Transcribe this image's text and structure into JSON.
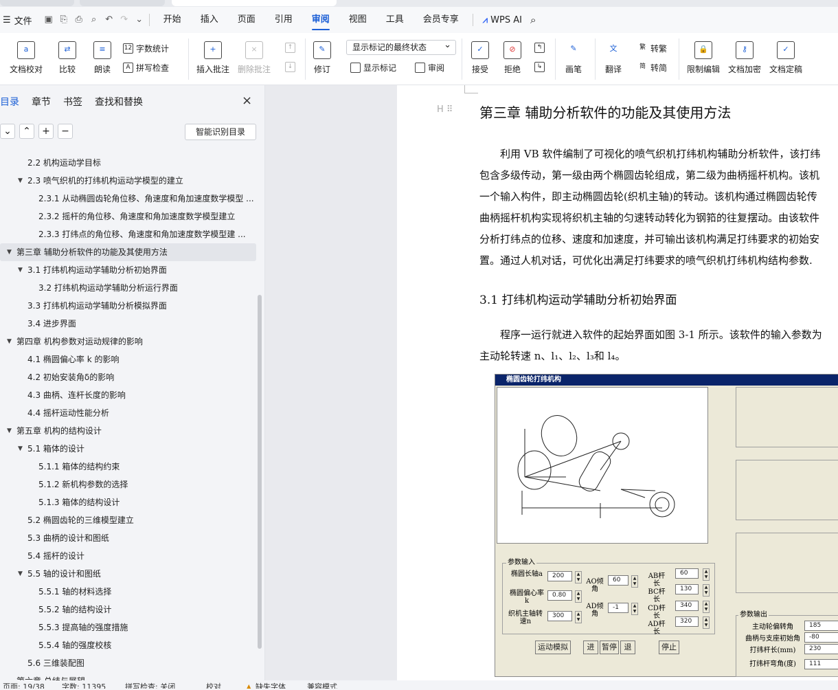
{
  "menu": {
    "file_label": "文件",
    "tabs": [
      "开始",
      "插入",
      "页面",
      "引用",
      "审阅",
      "视图",
      "工具",
      "会员专享"
    ],
    "active_tab": "审阅",
    "wps_ai": "WPS AI"
  },
  "ribbon": {
    "doc_check": "文档校对",
    "compare": "比较",
    "read_aloud": "朗读",
    "word_count": "字数统计",
    "spell_check": "拼写检查",
    "insert_comment": "插入批注",
    "delete_comment": "删除批注",
    "revise": "修订",
    "markup_state": "显示标记的最终状态",
    "show_markup": "显示标记",
    "review": "审阅",
    "accept": "接受",
    "reject": "拒绝",
    "pen": "画笔",
    "translate": "翻译",
    "to_traditional": "转繁",
    "to_simplified": "转简",
    "restrict_edit": "限制编辑",
    "encrypt": "文档加密",
    "finalize": "文档定稿"
  },
  "nav": {
    "tabs": [
      "目录",
      "章节",
      "书签",
      "查找和替换"
    ],
    "active_tab": "目录",
    "smart_toc": "智能识别目录",
    "items": [
      {
        "label": "2.2 机构运动学目标",
        "level": 2,
        "arrow": false
      },
      {
        "label": "2.3 喷气织机的打纬机构运动学模型的建立",
        "level": 2,
        "arrow": true
      },
      {
        "label": "2.3.1 从动椭圆齿轮角位移、角速度和角加速度数学模型 ...",
        "level": 3,
        "arrow": false
      },
      {
        "label": "2.3.2 摇杆的角位移、角速度和角加速度数学模型建立",
        "level": 3,
        "arrow": false
      },
      {
        "label": "2.3.3  打纬点的角位移、角速度和角加速度数学模型建 ...",
        "level": 3,
        "arrow": false
      },
      {
        "label": "第三章  辅助分析软件的功能及其使用方法",
        "level": 1,
        "arrow": true,
        "selected": true
      },
      {
        "label": "3.1  打纬机构运动学辅助分析初始界面",
        "level": 2,
        "arrow": true
      },
      {
        "label": "3.2 打纬机构运动学辅助分析运行界面",
        "level": 3,
        "arrow": false
      },
      {
        "label": "3.3  打纬机构运动学辅助分析模拟界面",
        "level": 2,
        "arrow": false
      },
      {
        "label": "3.4 进步界面",
        "level": 2,
        "arrow": false
      },
      {
        "label": "第四章  机构参数对运动规律的影响",
        "level": 1,
        "arrow": true
      },
      {
        "label": "4.1  椭圆偏心率 k 的影响",
        "level": 2,
        "arrow": false
      },
      {
        "label": "4.2  初始安装角δ的影响",
        "level": 2,
        "arrow": false
      },
      {
        "label": "4.3  曲柄、连杆长度的影响",
        "level": 2,
        "arrow": false
      },
      {
        "label": "4.4  摇杆运动性能分析",
        "level": 2,
        "arrow": false
      },
      {
        "label": "第五章  机构的结构设计",
        "level": 1,
        "arrow": true
      },
      {
        "label": "5.1  箱体的设计",
        "level": 2,
        "arrow": true
      },
      {
        "label": "5.1.1  箱体的结构约束",
        "level": 3,
        "arrow": false
      },
      {
        "label": "5.1.2  新机构参数的选择",
        "level": 3,
        "arrow": false
      },
      {
        "label": "5.1.3  箱体的结构设计",
        "level": 3,
        "arrow": false
      },
      {
        "label": "5.2  椭圆齿轮的三维模型建立",
        "level": 2,
        "arrow": false
      },
      {
        "label": "5.3  曲柄的设计和图纸",
        "level": 2,
        "arrow": false
      },
      {
        "label": "5.4  摇杆的设计",
        "level": 2,
        "arrow": false
      },
      {
        "label": "5.5 轴的设计和图纸",
        "level": 2,
        "arrow": true
      },
      {
        "label": "5.5.1  轴的材料选择",
        "level": 3,
        "arrow": false
      },
      {
        "label": "5.5.2  轴的结构设计",
        "level": 3,
        "arrow": false
      },
      {
        "label": "5.5.3 提高轴的强度措施",
        "level": 3,
        "arrow": false
      },
      {
        "label": "5.5.4  轴的强度校核",
        "level": 3,
        "arrow": false
      },
      {
        "label": "5.6  三维装配图",
        "level": 2,
        "arrow": false
      },
      {
        "label": "第六章  总结与展望",
        "level": 1,
        "arrow": false
      }
    ]
  },
  "doc": {
    "heading": "第三章  辅助分析软件的功能及其使用方法",
    "para1": [
      "利用 VB 软件编制了可视化的喷气织机打纬机构辅助分析软件，该打纬",
      "包含多级传动，第一级由两个椭圆齿轮组成，第二级为曲柄摇杆机构。该机",
      "一个输入构件，即主动椭圆齿轮(织机主轴)的转动。该机构通过椭圆齿轮传",
      "曲柄摇杆机构实现将织机主轴的匀速转动转化为钢筘的往复摆动。由该软件",
      "分析打纬点的位移、速度和加速度，并可输出该机构满足打纬要求的初始安",
      "置。通过人机对话，可优化出满足打纬要求的喷气织机打纬机构结构参数."
    ],
    "subheading": "3.1  打纬机构运动学辅助分析初始界面",
    "para2": [
      "程序一运行就进入软件的起始界面如图 3-1 所示。该软件的输入参数为",
      "主动轮转速 n、l₁、l₂、l₃和 l₄。"
    ]
  },
  "figure": {
    "title": "椭圆齿轮打纬机构",
    "input_group": "参数输入",
    "ellipse_long_axis": "椭圆长轴a",
    "ellipse_long_axis_val": "200",
    "eccentricity": "椭圆偏心率k",
    "eccentricity_val": "0.80",
    "spindle_speed": "织机主轴转速n",
    "spindle_speed_val": "300",
    "ao_angle": "AO倾角",
    "ao_angle_val": "60",
    "ad_angle": "AD倾角",
    "ad_angle_val": "-1",
    "ab": "AB杆长",
    "ab_val": "60",
    "bc": "BC杆长",
    "bc_val": "130",
    "cd": "CD杆长",
    "cd_val": "340",
    "ad": "AD杆长",
    "ad_val": "320",
    "btn_sim": "运动模拟",
    "btn_go": "进",
    "btn_pause": "暂停",
    "btn_back": "退",
    "btn_stop": "停止",
    "output_group": "参数输出",
    "out1": "主动轮偏转角",
    "out1_val": "185",
    "out2": "曲柄与支座初始角",
    "out2_val": "-80",
    "out3": "打纬杆长(mm)",
    "out3_val": "230",
    "out4": "打纬杆弯角(度)",
    "out4_val": "111"
  },
  "status": {
    "page": "页面: 19/38",
    "words": "字数: 11395",
    "spell": "拼写检查: 关闭",
    "proof": "校对",
    "missing_font": "缺失字体",
    "compat": "兼容模式"
  }
}
